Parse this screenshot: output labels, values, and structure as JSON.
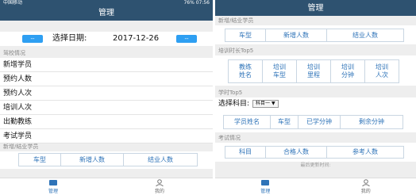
{
  "left": {
    "status": {
      "carrier": "中国移动",
      "right": "76% 07:56"
    },
    "title": "管理",
    "date_bar": {
      "prev_label": "--",
      "label": "选择日期:",
      "value": "2017-12-26",
      "next_label": "--"
    },
    "school_section": {
      "title": "驾校情况",
      "items": [
        "新增学员",
        "预约人数",
        "预约人次",
        "培训人次",
        "出勤教练",
        "考试学员"
      ]
    },
    "enroll_section": {
      "title": "新增/结业学员",
      "headers": [
        "车型",
        "新增人数",
        "结业人数"
      ]
    },
    "tabs": [
      {
        "label": "管理",
        "active": true
      },
      {
        "label": "我的",
        "active": false
      }
    ]
  },
  "right": {
    "title": "管理",
    "enroll_section": {
      "title": "新增/结业学员",
      "headers": [
        "车型",
        "新增人数",
        "结业人数"
      ]
    },
    "top5_section": {
      "title": "培训时长Top5",
      "headers": [
        "教练\n姓名",
        "培训\n车型",
        "培训\n里程",
        "培训\n分钟",
        "培训\n人次"
      ]
    },
    "hours_section": {
      "title": "学时Top5",
      "select_label": "选择科目:",
      "select_value": "科目一 ▼",
      "headers": [
        "学员姓名",
        "车型",
        "已学分钟",
        "剩余分钟"
      ]
    },
    "exam_section": {
      "title": "考试情况",
      "headers": [
        "科目",
        "合格人数",
        "参考人数"
      ]
    },
    "footer_note": "最后更新时间:",
    "tabs": [
      {
        "label": "管理",
        "active": true
      },
      {
        "label": "我的",
        "active": false
      }
    ]
  },
  "colors": {
    "header": "#2e5270",
    "accent": "#2e9ff2",
    "link": "#2e73b8"
  }
}
